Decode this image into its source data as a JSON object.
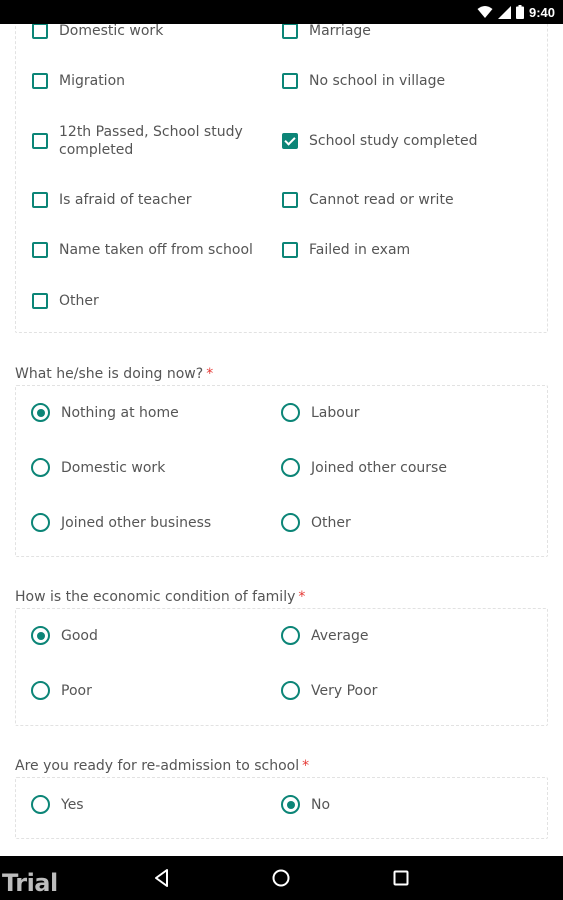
{
  "status_bar": {
    "time": "9:40"
  },
  "sections": {
    "reasons": {
      "options": [
        {
          "label": "Domestic work",
          "checked": false
        },
        {
          "label": "Marriage",
          "checked": false
        },
        {
          "label": "Migration",
          "checked": false
        },
        {
          "label": "No school in village",
          "checked": false
        },
        {
          "label": "12th Passed, School study completed",
          "checked": false
        },
        {
          "label": "School study completed",
          "checked": true
        },
        {
          "label": "Is afraid of teacher",
          "checked": false
        },
        {
          "label": "Cannot read or write",
          "checked": false
        },
        {
          "label": "Name taken off from school",
          "checked": false
        },
        {
          "label": "Failed in exam",
          "checked": false
        },
        {
          "label": "Other",
          "checked": false
        }
      ]
    },
    "doing_now": {
      "question": "What he/she is doing now?",
      "required_mark": "*",
      "options": [
        {
          "label": "Nothing at home",
          "selected": true
        },
        {
          "label": "Labour",
          "selected": false
        },
        {
          "label": "Domestic work",
          "selected": false
        },
        {
          "label": "Joined other course",
          "selected": false
        },
        {
          "label": "Joined other business",
          "selected": false
        },
        {
          "label": "Other",
          "selected": false
        }
      ]
    },
    "economic": {
      "question": "How is the economic condition of family",
      "required_mark": "*",
      "options": [
        {
          "label": "Good",
          "selected": true
        },
        {
          "label": "Average",
          "selected": false
        },
        {
          "label": "Poor",
          "selected": false
        },
        {
          "label": "Very Poor",
          "selected": false
        }
      ]
    },
    "readmission": {
      "question": "Are you ready for re-admission to school",
      "required_mark": "*",
      "options": [
        {
          "label": "Yes",
          "selected": false
        },
        {
          "label": "No",
          "selected": true
        }
      ]
    }
  },
  "watermark": "Trial",
  "colors": {
    "accent": "#0c8577",
    "required": "#e53935"
  },
  "nav": {
    "back_icon": "back-triangle-icon",
    "home_icon": "home-circle-icon",
    "recents_icon": "recents-square-icon"
  }
}
